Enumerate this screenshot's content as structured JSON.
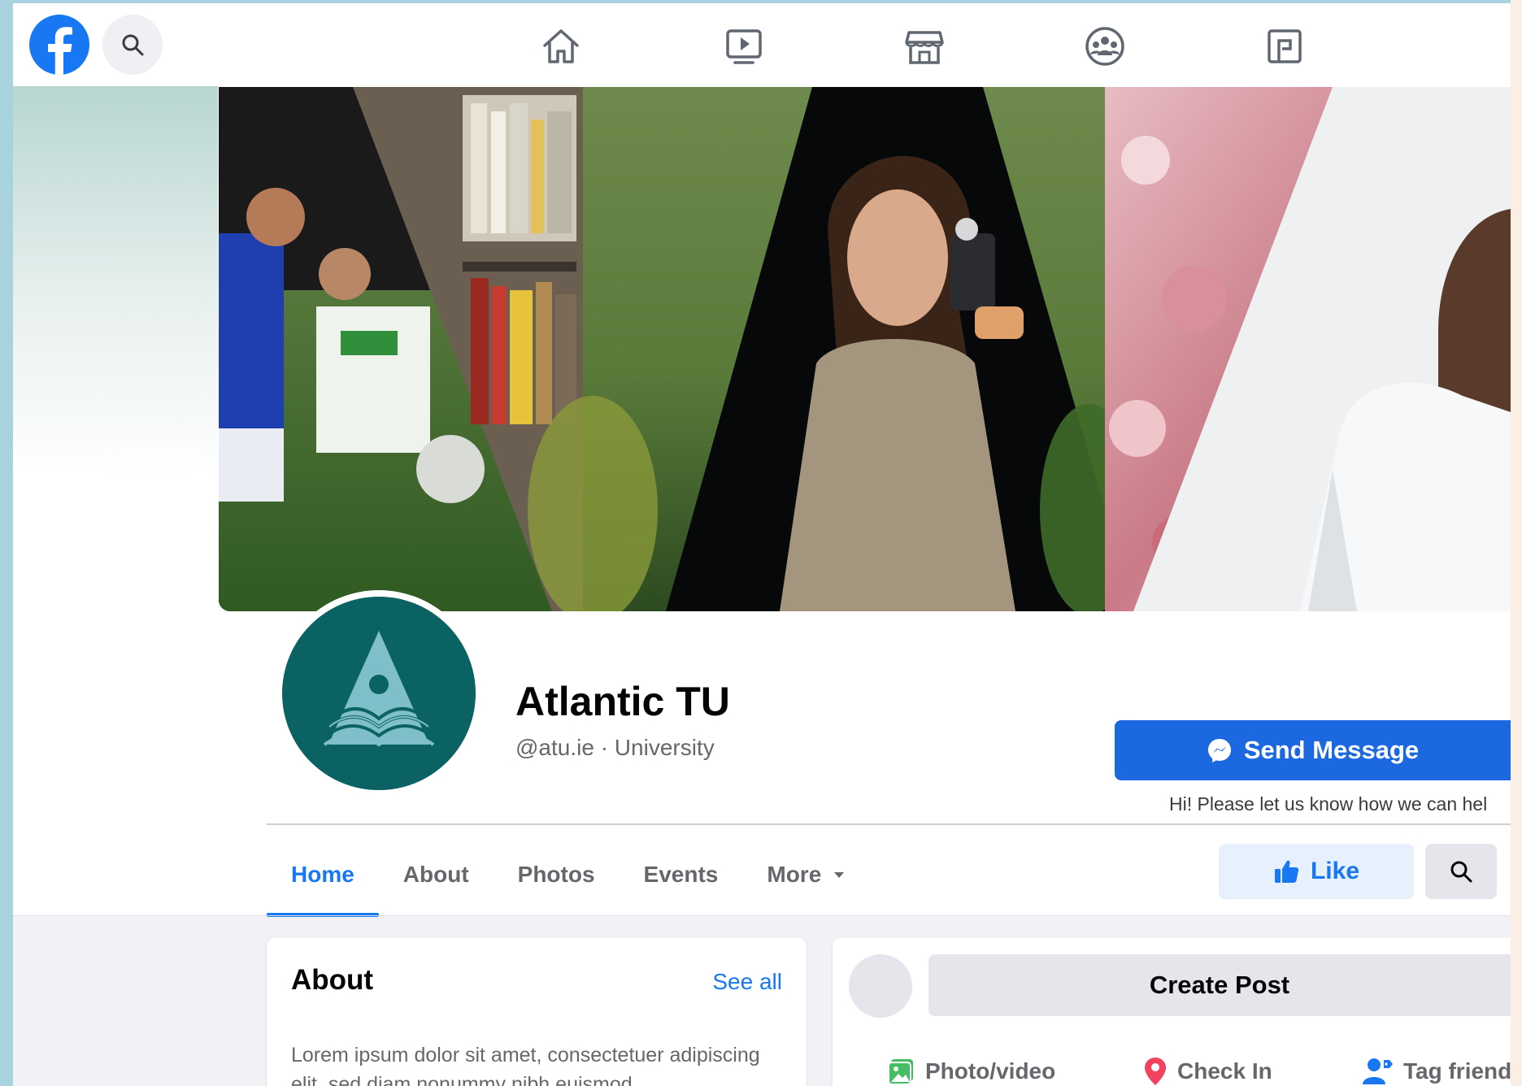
{
  "brand": {
    "accent": "#1877f2",
    "profile_bg": "#0b6262"
  },
  "nav": {
    "icons": [
      "home-icon",
      "watch-icon",
      "marketplace-icon",
      "groups-icon",
      "gaming-icon"
    ]
  },
  "page": {
    "name": "Atlantic TU",
    "subtitle": "@atu.ie · University"
  },
  "actions": {
    "send_message_label": "Send Message",
    "helper_text": "Hi! Please let us know how we can hel",
    "like_label": "Like"
  },
  "tabs": [
    {
      "label": "Home",
      "active": true
    },
    {
      "label": "About",
      "active": false
    },
    {
      "label": "Photos",
      "active": false
    },
    {
      "label": "Events",
      "active": false
    },
    {
      "label": "More",
      "active": false
    }
  ],
  "about": {
    "title": "About",
    "see_all": "See all",
    "text": "Lorem ipsum dolor sit amet, consectetuer adipiscing elit, sed diam nonummy nibh euismod"
  },
  "create_post": {
    "button_label": "Create Post",
    "actions": [
      {
        "label": "Photo/video",
        "icon": "photo-video-icon"
      },
      {
        "label": "Check In",
        "icon": "location-pin-icon"
      },
      {
        "label": "Tag friend",
        "icon": "tag-friend-icon"
      }
    ]
  }
}
